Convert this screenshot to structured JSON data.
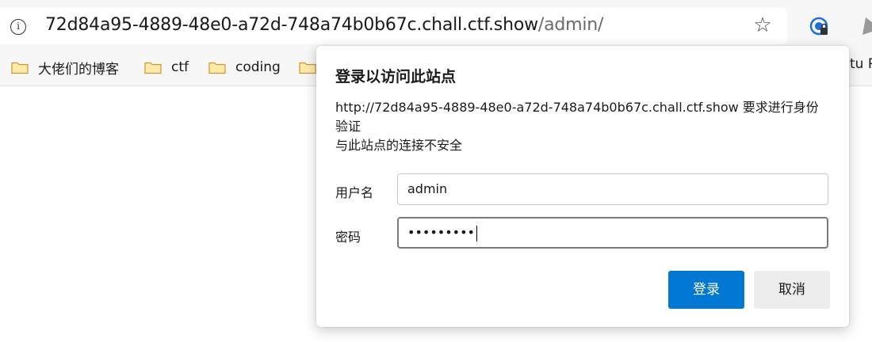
{
  "browser": {
    "url_host": "72d84a95-4889-48e0-a72d-748a74b0b67c.chall.ctf.show",
    "url_path": "/admin/",
    "bookmarks": [
      {
        "label": "大佬们的博客"
      },
      {
        "label": "ctf"
      },
      {
        "label": "coding"
      },
      {
        "label": ""
      }
    ],
    "clipped_bookmark": "tu P"
  },
  "dialog": {
    "title": "登录以访问此站点",
    "message_line1": "http://72d84a95-4889-48e0-a72d-748a74b0b67c.chall.ctf.show 要求进行身份",
    "message_line2": "验证",
    "message_line3": "与此站点的连接不安全",
    "username_label": "用户名",
    "username_value": "admin",
    "password_label": "密码",
    "password_value": "•••••••••",
    "login_button": "登录",
    "cancel_button": "取消"
  },
  "colors": {
    "primary": "#0078d4",
    "folder": "#f5c542"
  },
  "icons": [
    "info-icon",
    "star-icon",
    "extension-icon",
    "folder-icon"
  ]
}
